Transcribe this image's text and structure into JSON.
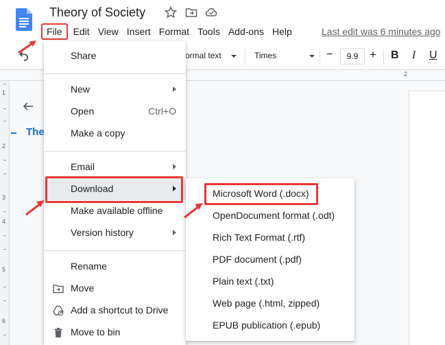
{
  "app": {
    "doc_title": "Theory of Society",
    "last_edit": "Last edit was 6 minutes ago"
  },
  "menubar": [
    "File",
    "Edit",
    "View",
    "Insert",
    "Format",
    "Tools",
    "Add-ons",
    "Help"
  ],
  "toolbar": {
    "style": "ormal text",
    "font": "Times",
    "font_size": "9.9",
    "minus": "−",
    "plus": "+",
    "bold": "B",
    "italic": "I",
    "underline": "U",
    "ruler_num": "2"
  },
  "ruler_left": [
    "1",
    "2",
    "3",
    "4",
    "5",
    "6"
  ],
  "outline": {
    "heading": "The"
  },
  "file_menu": {
    "share": "Share",
    "new": "New",
    "open": "Open",
    "open_shortcut": "Ctrl+O",
    "make_copy": "Make a copy",
    "email": "Email",
    "download": "Download",
    "offline": "Make available offline",
    "version_history": "Version history",
    "rename": "Rename",
    "move": "Move",
    "shortcut": "Add a shortcut to Drive",
    "bin": "Move to bin"
  },
  "download_menu": [
    "Microsoft Word (.docx)",
    "OpenDocument format (.odt)",
    "Rich Text Format (.rtf)",
    "PDF document (.pdf)",
    "Plain text (.txt)",
    "Web page (.html, zipped)",
    "EPUB publication (.epub)"
  ],
  "colors": {
    "annotation_red": "#e53935",
    "docs_blue": "#4285f4",
    "outline_blue": "#1967d2"
  }
}
